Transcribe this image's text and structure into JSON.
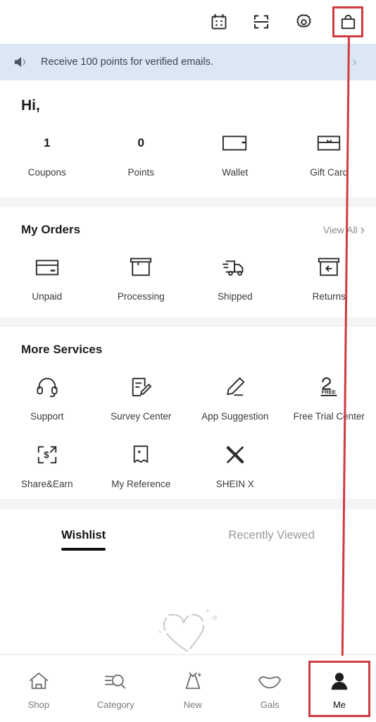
{
  "topbar": {
    "icons": [
      {
        "name": "calendar-checkin-icon",
        "label": "Check-in"
      },
      {
        "name": "scan-icon",
        "label": "Scan"
      },
      {
        "name": "gear-icon",
        "label": "Settings"
      },
      {
        "name": "shopping-bag-icon",
        "label": "Bag"
      }
    ]
  },
  "banner": {
    "icon": "megaphone-icon",
    "text": "Receive 100 points for verified emails.",
    "chevron": "›",
    "background": "#dbe7f4"
  },
  "greeting": {
    "text": "Hi,"
  },
  "assets": {
    "items": [
      {
        "value": "1",
        "label": "Coupons",
        "icon": null
      },
      {
        "value": "0",
        "label": "Points",
        "icon": null
      },
      {
        "value": null,
        "label": "Wallet",
        "icon": "wallet-icon"
      },
      {
        "value": null,
        "label": "Gift Card",
        "icon": "gift-card-icon"
      }
    ]
  },
  "orders": {
    "title": "My Orders",
    "view_all": "View All",
    "chevron": "›",
    "items": [
      {
        "label": "Unpaid",
        "icon": "credit-card-icon"
      },
      {
        "label": "Processing",
        "icon": "package-box-icon"
      },
      {
        "label": "Shipped",
        "icon": "delivery-truck-icon"
      },
      {
        "label": "Returns",
        "icon": "return-box-icon"
      }
    ]
  },
  "services": {
    "title": "More Services",
    "row1": [
      {
        "label": "Support",
        "icon": "headset-icon"
      },
      {
        "label": "Survey Center",
        "icon": "survey-pencil-icon"
      },
      {
        "label": "App Suggestion",
        "icon": "pencil-icon"
      },
      {
        "label": "Free Trial Center",
        "icon": "free-trial-icon",
        "badge": "FREE"
      }
    ],
    "row2": [
      {
        "label": "Share&Earn",
        "icon": "share-earn-icon"
      },
      {
        "label": "My Reference",
        "icon": "reference-ribbon-icon"
      },
      {
        "label": "SHEIN X",
        "icon": "shein-x-icon"
      },
      {
        "label": "",
        "icon": null
      }
    ]
  },
  "tabs": {
    "items": [
      {
        "label": "Wishlist",
        "active": true
      },
      {
        "label": "Recently Viewed",
        "active": false
      }
    ]
  },
  "empty_state": {
    "icon": "heart-outline-icon"
  },
  "bottom_nav": {
    "items": [
      {
        "label": "Shop",
        "icon": "home-icon",
        "active": false,
        "highlighted": false
      },
      {
        "label": "Category",
        "icon": "category-search-icon",
        "active": false,
        "highlighted": false
      },
      {
        "label": "New",
        "icon": "dress-sparkle-icon",
        "active": false,
        "highlighted": false
      },
      {
        "label": "Gals",
        "icon": "lips-icon",
        "active": false,
        "highlighted": false
      },
      {
        "label": "Me",
        "icon": "person-icon",
        "active": true,
        "highlighted": true
      }
    ]
  },
  "annotation": {
    "color": "#cf3b42",
    "description": "red line connecting shopping bag icon to Me tab"
  }
}
